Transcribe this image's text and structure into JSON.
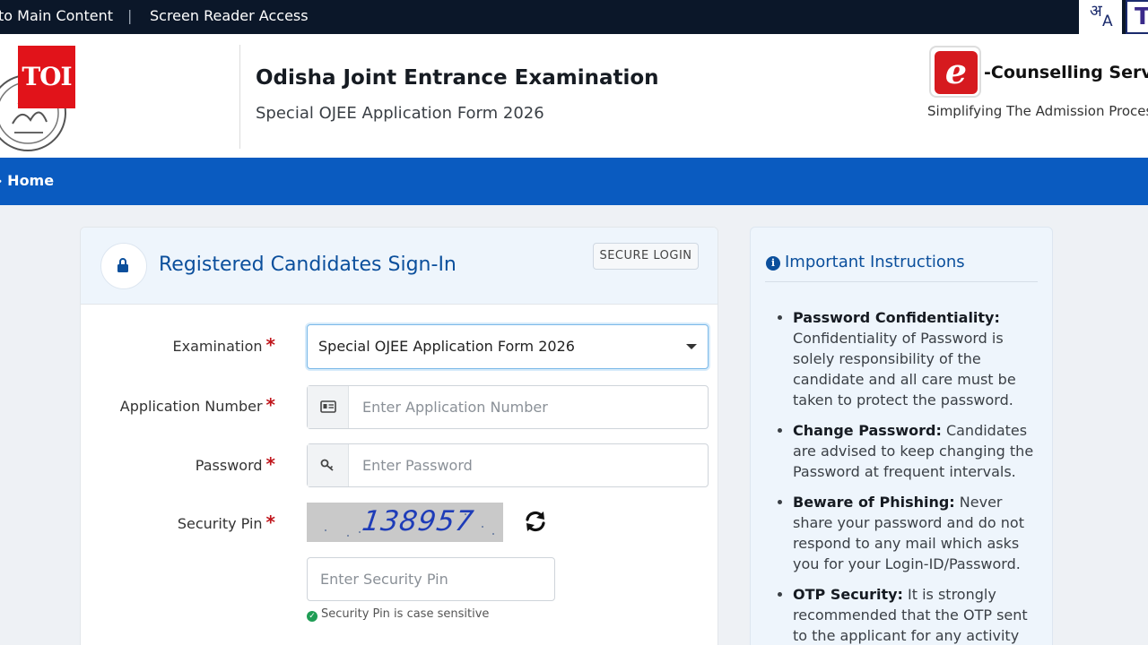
{
  "topbar": {
    "skip_link": "to Main Content",
    "separator": "|",
    "screen_reader": "Screen Reader Access",
    "lang_glyph_1": "अ",
    "lang_glyph_2": "A",
    "text_size_glyph": "T"
  },
  "header": {
    "watermark": "TOI",
    "title": "Odisha Joint Entrance Examination",
    "subtitle": "Special OJEE Application Form 2026",
    "ec_logo_letter": "e",
    "ec_title": "-Counselling Services",
    "ec_tagline": "Simplifying The Admission Process"
  },
  "nav": {
    "home": "Home"
  },
  "signin": {
    "title": "Registered Candidates Sign-In",
    "badge": "SECURE LOGIN",
    "required_mark": "*",
    "examination_label": "Examination",
    "examination_value": "Special OJEE Application Form 2026",
    "application_label": "Application Number",
    "application_placeholder": "Enter Application Number",
    "password_label": "Password",
    "password_placeholder": "Enter Password",
    "pin_label": "Security Pin",
    "captcha_code": "138957",
    "pin_placeholder": "Enter Security Pin",
    "pin_hint": "Security Pin is case sensitive"
  },
  "instructions": {
    "title": "Important Instructions",
    "items": [
      {
        "heading": "Password Confidentiality:",
        "text": "Confidentiality of Password is solely responsibility of the candidate and all care must be taken to protect the password."
      },
      {
        "heading": "Change Password:",
        "text": "Candidates are advised to keep changing the Password at frequent intervals."
      },
      {
        "heading": "Beware of Phishing:",
        "text": "Never share your password and do not respond to any mail which asks you for your Login-ID/Password."
      },
      {
        "heading": "OTP Security:",
        "text": "It is strongly recommended that the OTP sent to the applicant for any activity"
      }
    ]
  },
  "colors": {
    "topbar": "#0b1729",
    "nav": "#0a5bc0",
    "accent": "#0b4f9c",
    "required": "#c0161c",
    "toi_red": "#e1131a"
  }
}
